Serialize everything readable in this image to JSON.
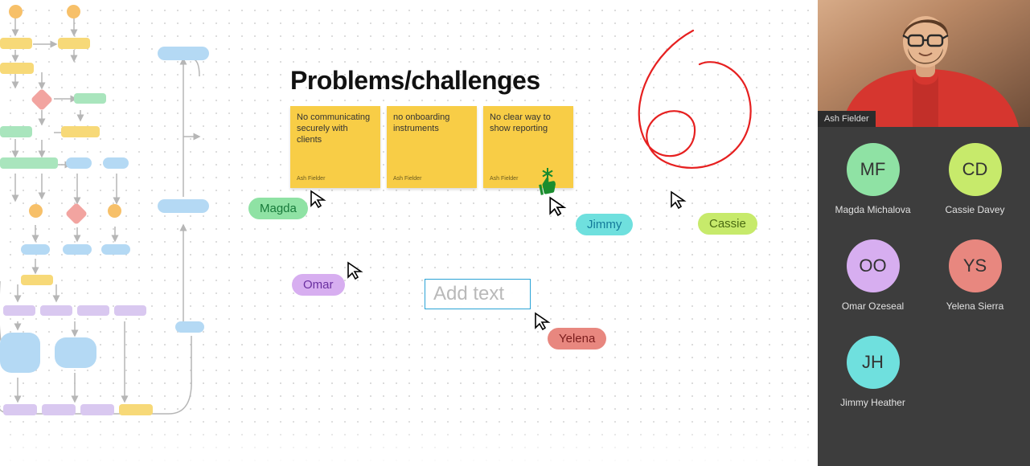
{
  "heading": "Problems/challenges",
  "stickies": [
    {
      "text": "No communicating securely with clients",
      "author": "Ash Fielder"
    },
    {
      "text": "no onboarding instruments",
      "author": "Ash Fielder"
    },
    {
      "text": "No clear way to show reporting",
      "author": "Ash Fielder"
    }
  ],
  "textbox": {
    "placeholder": "Add text"
  },
  "cursors": {
    "magda": {
      "label": "Magda",
      "pill_bg": "#8fe2a4",
      "pill_fg": "#177a3a"
    },
    "omar": {
      "label": "Omar",
      "pill_bg": "#d7aef0",
      "pill_fg": "#6a2fa0"
    },
    "jimmy": {
      "label": "Jimmy",
      "pill_bg": "#6fe0de",
      "pill_fg": "#137a9a"
    },
    "yelena": {
      "label": "Yelena",
      "pill_bg": "#e8877f",
      "pill_fg": "#7a1c1c"
    },
    "cassie": {
      "label": "Cassie",
      "pill_bg": "#c7ea6b",
      "pill_fg": "#4a6a12"
    }
  },
  "scribble_color": "#e62020",
  "video": {
    "name": "Ash Fielder"
  },
  "participants": [
    {
      "initials": "MF",
      "name": "Magda Michalova",
      "color": "#8fe2a4"
    },
    {
      "initials": "CD",
      "name": "Cassie Davey",
      "color": "#c7ea6b"
    },
    {
      "initials": "OO",
      "name": "Omar Ozeseal",
      "color": "#d7aef0"
    },
    {
      "initials": "YS",
      "name": "Yelena Sierra",
      "color": "#e8877f"
    },
    {
      "initials": "JH",
      "name": "Jimmy Heather",
      "color": "#6fe0de"
    }
  ]
}
